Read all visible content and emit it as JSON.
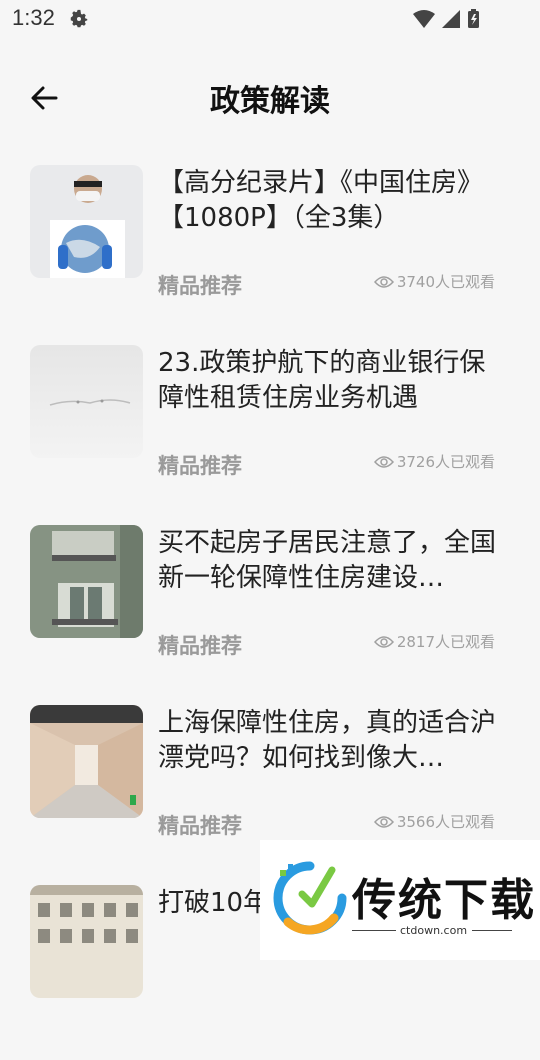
{
  "status": {
    "time": "1:32"
  },
  "header": {
    "title": "政策解读"
  },
  "items": [
    {
      "title": "【高分纪录片】《中国住房》【1080P】（全3集）",
      "tag": "精品推荐",
      "views": "3740人已观看"
    },
    {
      "title": "23.政策护航下的商业银行保障性租赁住房业务机遇",
      "tag": "精品推荐",
      "views": "3726人已观看"
    },
    {
      "title": "买不起房子居民注意了，全国新一轮保障性住房建设…",
      "tag": "精品推荐",
      "views": "2817人已观看"
    },
    {
      "title": "上海保障性住房，真的适合沪漂党吗？如何找到像大…",
      "tag": "精品推荐",
      "views": "3566人已观看"
    },
    {
      "title": "打破10年…读上海调…",
      "tag": "",
      "views": ""
    }
  ],
  "watermark": {
    "brand": "传统下载",
    "site": "ctdown.com"
  },
  "icons": [
    "gear-icon",
    "wifi-icon",
    "signal-icon",
    "battery-icon",
    "back-arrow-icon",
    "eye-icon"
  ]
}
